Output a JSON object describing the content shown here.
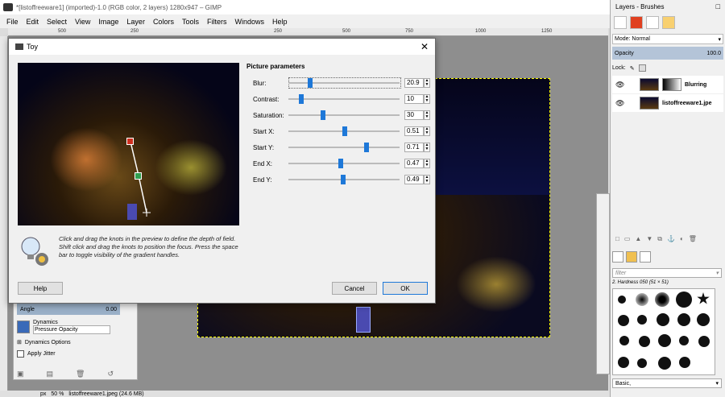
{
  "window": {
    "title": "*[listoffreeware1] (imported)-1.0 (RGB color, 2 layers) 1280x947 – GIMP"
  },
  "menu": [
    "File",
    "Edit",
    "Select",
    "View",
    "Image",
    "Layer",
    "Colors",
    "Tools",
    "Filters",
    "Windows",
    "Help"
  ],
  "ruler": [
    "500",
    "250",
    "250",
    "500",
    "750",
    "1000",
    "1250"
  ],
  "statusbar": {
    "unit": "px",
    "zoom": "50 %",
    "file": "listoffreeware1.jpeg (24.6 MB)"
  },
  "tool_options": {
    "angle_label": "Angle",
    "angle_value": "0.00",
    "dynamics_label": "Dynamics",
    "dynamics_value": "Pressure Opacity",
    "dynamics_options": "Dynamics Options",
    "apply_jitter": "Apply Jitter"
  },
  "dialog": {
    "title": "Toy",
    "params_title": "Picture parameters",
    "params": [
      {
        "label": "Blur:",
        "value": "20.9",
        "pos": 0.18
      },
      {
        "label": "Contrast:",
        "value": "10",
        "pos": 0.1
      },
      {
        "label": "Saturation:",
        "value": "30",
        "pos": 0.3
      },
      {
        "label": "Start X:",
        "value": "0.51",
        "pos": 0.51
      },
      {
        "label": "Start Y:",
        "value": "0.71",
        "pos": 0.71
      },
      {
        "label": "End X:",
        "value": "0.47",
        "pos": 0.47
      },
      {
        "label": "End Y:",
        "value": "0.49",
        "pos": 0.49
      }
    ],
    "hint": "Click and drag the knots in the preview to define the depth of field. Shift click and drag the knots to position the focus. Press the space bar to toggle visibility of the gradient handles.",
    "help": "Help",
    "cancel": "Cancel",
    "ok": "OK"
  },
  "layers_panel": {
    "title": "Layers - Brushes",
    "mode_label": "Mode:",
    "mode_value": "Normal",
    "opacity_label": "Opacity",
    "opacity_value": "100.0",
    "lock_label": "Lock:",
    "layers": [
      {
        "name": "Blurring"
      },
      {
        "name": "listoffreeware1.jpe"
      }
    ],
    "filter_placeholder": "filter",
    "brush_name": "2. Hardness 050 (51 × 51)",
    "brush_set": "Basic,"
  }
}
